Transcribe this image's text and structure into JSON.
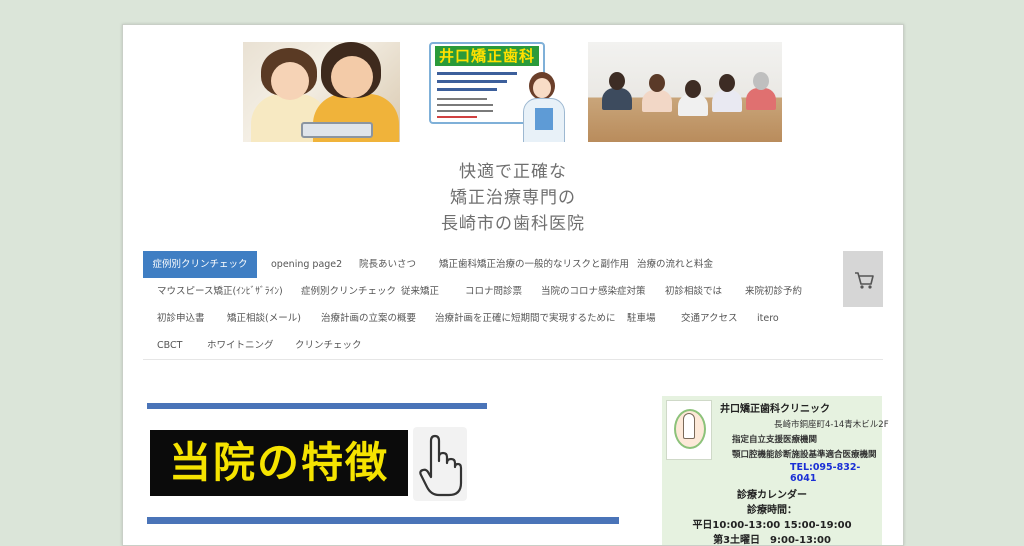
{
  "header": {
    "clinic_logo_text": "井口矯正歯科",
    "title_lines": [
      "快適で正確な",
      "矯正治療専門の",
      "長崎市の歯科医院"
    ]
  },
  "nav": {
    "rows": [
      [
        {
          "label": "症例別クリンチェック",
          "active": true
        },
        {
          "label": "opening page2"
        },
        {
          "label": "院長あいさつ"
        },
        {
          "label": "矯正歯科矯正治療の一般的なリスクと副作用"
        },
        {
          "label": "治療の流れと料金"
        }
      ],
      [
        {
          "label": "マウスピース矯正(ｲﾝﾋﾞｻﾞﾗｲﾝ)"
        },
        {
          "label": "症例別クリンチェック"
        },
        {
          "label": "従来矯正"
        },
        {
          "label": "コロナ問診票"
        },
        {
          "label": "当院のコロナ感染症対策"
        },
        {
          "label": "初診相談では"
        },
        {
          "label": "来院初診予約"
        }
      ],
      [
        {
          "label": "初診申込書"
        },
        {
          "label": "矯正相談(メール)"
        },
        {
          "label": "治療計画の立案の概要"
        },
        {
          "label": "治療計画を正確に短期間で実現するために"
        },
        {
          "label": "駐車場"
        },
        {
          "label": "交通アクセス"
        },
        {
          "label": "itero"
        }
      ],
      [
        {
          "label": "CBCT"
        },
        {
          "label": "ホワイトニング"
        },
        {
          "label": "クリンチェック"
        }
      ]
    ],
    "cart_icon": "cart-icon"
  },
  "main": {
    "feature_banner": "当院の特徴",
    "hand_icon": "pointing-hand-icon"
  },
  "sidebar": {
    "clinic_name": "井口矯正歯科クリニック",
    "address": "長崎市銅座町4-14青木ビル2F",
    "designation1": "指定自立支援医療機関",
    "designation2": "顎口腔機能診断施設基準適合医療機関",
    "tel": "TEL:095-832-6041",
    "calendar_heading": "診療カレンダー",
    "hours_heading": "診療時間：",
    "hours_weekday": "平日10:00-13:00 15:00-19:00",
    "hours_saturday_partial": "第3土曜日　9:00-13:00"
  },
  "colors": {
    "accent_blue": "#3f7ec3",
    "bar_blue": "#4a74b8",
    "banner_yellow": "#f5e300",
    "tel_blue": "#1a2fd6",
    "sidebar_bg": "#e6f2e0"
  }
}
